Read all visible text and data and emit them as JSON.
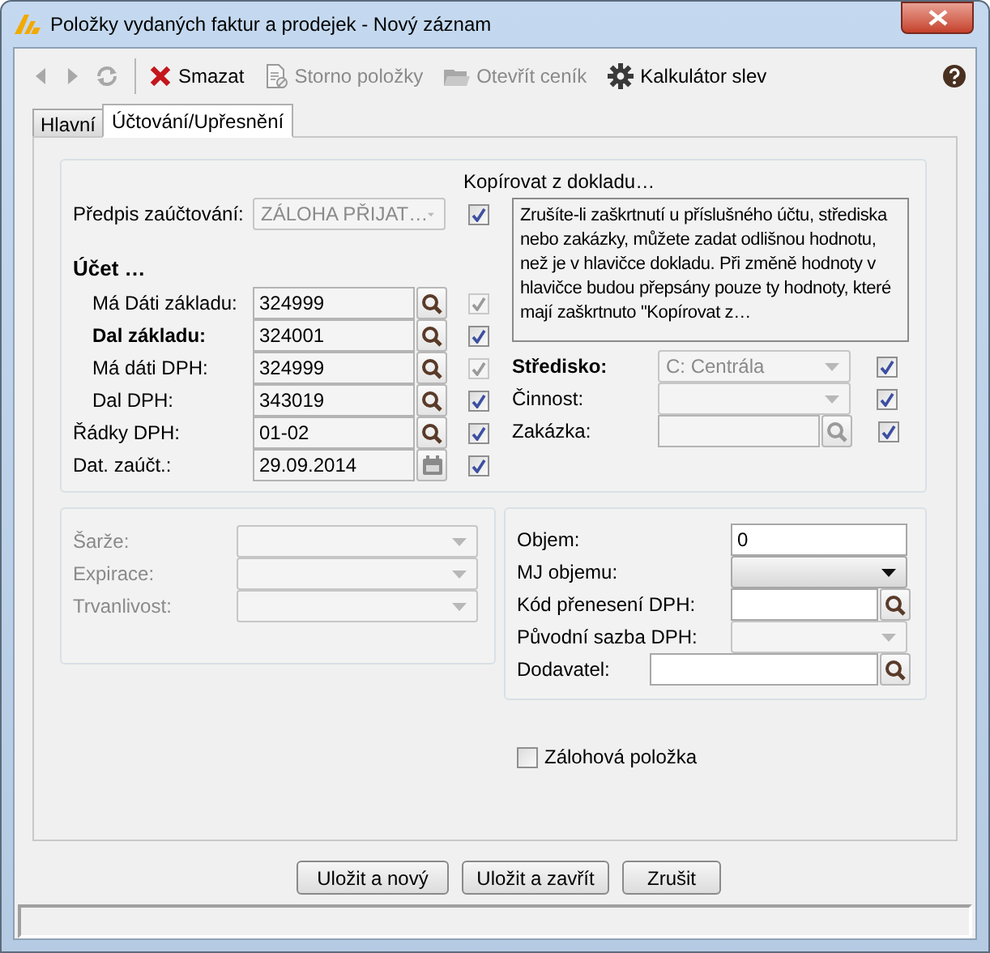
{
  "window": {
    "title": "Položky vydaných faktur a prodejek - Nový záznam"
  },
  "toolbar": {
    "navigation": [
      {
        "kind": "back",
        "disabled": true
      },
      {
        "kind": "forward",
        "disabled": true
      },
      {
        "kind": "refresh",
        "disabled": true
      }
    ],
    "actions": [
      {
        "kind": "delete",
        "label": "Smazat",
        "disabled": false
      },
      {
        "kind": "document",
        "label": "Storno položky",
        "disabled": true
      },
      {
        "kind": "folder",
        "label": "Otevřít ceník",
        "disabled": true
      },
      {
        "kind": "gear",
        "label": "Kalkulátor slev",
        "disabled": false
      }
    ]
  },
  "tabs": [
    {
      "label": "Hlavní",
      "selected": false
    },
    {
      "label": "Účtování/Upřesnění",
      "selected": true
    }
  ],
  "posting": {
    "copy_heading": "Kopírovat z dokladu…",
    "rule": {
      "label": "Předpis zaúčtování:",
      "value": "ZÁLOHA PŘIJAT…",
      "disabled": true,
      "copy": {
        "checked": true,
        "disabled": false
      }
    },
    "account_heading": "Účet …",
    "accounts": [
      {
        "label": "Má Dáti základu:",
        "bold": false,
        "indented": true,
        "value": "324999",
        "kind": "lookup",
        "copy": {
          "checked": true,
          "disabled": true
        }
      },
      {
        "label": "Dal základu:",
        "bold": true,
        "indented": true,
        "value": "324001",
        "kind": "lookup",
        "copy": {
          "checked": true,
          "disabled": false
        }
      },
      {
        "label": "Má dáti DPH:",
        "bold": false,
        "indented": true,
        "value": "324999",
        "kind": "lookup",
        "copy": {
          "checked": true,
          "disabled": true
        }
      },
      {
        "label": "Dal DPH:",
        "bold": false,
        "indented": true,
        "value": "343019",
        "kind": "lookup",
        "copy": {
          "checked": true,
          "disabled": false
        }
      },
      {
        "label": "Řádky DPH:",
        "bold": false,
        "indented": false,
        "value": "01-02",
        "kind": "lookup",
        "copy": {
          "checked": true,
          "disabled": false
        }
      },
      {
        "label": "Dat. zaúčt.:",
        "bold": false,
        "indented": false,
        "value": "29.09.2014",
        "kind": "calendar",
        "copy": {
          "checked": true,
          "disabled": false
        }
      }
    ],
    "note": "Zrušíte-li zaškrtnutí u příslušného účtu, střediska nebo zakázky, můžete zadat odlišnou hodnotu, než je v hlavičce dokladu. Při změně hodnoty v hlavičce budou přepsány pouze ty hodnoty, které mají zaškrtnuto \"Kopírovat z…",
    "assignments": [
      {
        "label": "Středisko:",
        "bold": true,
        "kind": "combo",
        "value": "C: Centrála",
        "disabled": true,
        "copy": {
          "checked": true,
          "disabled": false
        }
      },
      {
        "label": "Činnost:",
        "bold": false,
        "kind": "combo",
        "disabled": true,
        "copy": {
          "checked": true,
          "disabled": false
        }
      },
      {
        "label": "Zakázka:",
        "bold": false,
        "kind": "lookup",
        "disabled": true,
        "copy": {
          "checked": true,
          "disabled": false
        }
      }
    ]
  },
  "batch": {
    "rows": [
      {
        "label": "Šarže:",
        "disabled": true
      },
      {
        "label": "Expirace:",
        "disabled": true
      },
      {
        "label": "Trvanlivost:",
        "disabled": true
      }
    ]
  },
  "details": {
    "rows": [
      {
        "kind": "text",
        "label": "Objem:",
        "value": "0"
      },
      {
        "kind": "combo",
        "label": "MJ objemu:",
        "disabled": false
      },
      {
        "kind": "lookup",
        "label": "Kód přenesení DPH:",
        "wide": false
      },
      {
        "kind": "combo",
        "label": "Původní sazba DPH:",
        "disabled": true
      },
      {
        "kind": "lookup",
        "label": "Dodavatel:",
        "wide": true
      }
    ]
  },
  "advance_item": {
    "label": "Zálohová položka",
    "checked": false
  },
  "buttons": [
    "Uložit a nový",
    "Uložit a zavřít",
    "Zrušit"
  ]
}
